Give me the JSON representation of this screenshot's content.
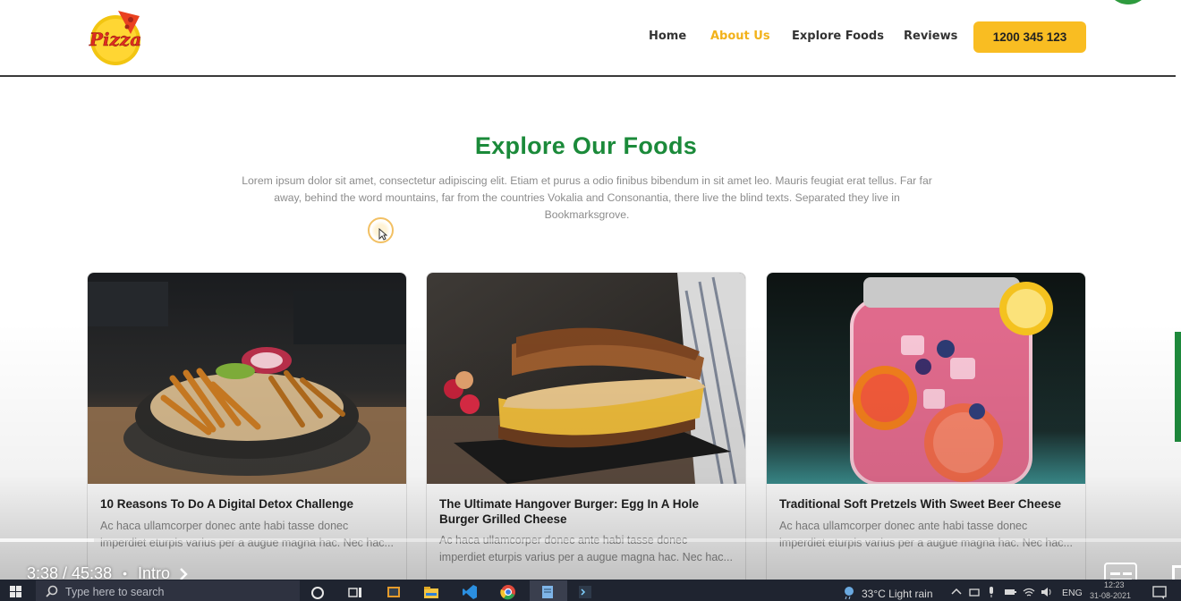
{
  "brand": {
    "logo_text": "Pizza"
  },
  "nav": [
    {
      "label": "Home",
      "active": false
    },
    {
      "label": "About Us",
      "active": true
    },
    {
      "label": "Explore Foods",
      "active": false
    },
    {
      "label": "Reviews",
      "active": false
    }
  ],
  "phone_button": "1200 345 123",
  "colors": {
    "accent": "#f9bd22",
    "brand_green": "#1b8a3a",
    "nav_active": "#f2b21b"
  },
  "section": {
    "title": "Explore Our Foods",
    "description": "Lorem ipsum dolor sit amet, consectetur adipiscing elit. Etiam et purus a odio finibus bibendum in sit amet leo. Mauris feugiat erat tellus. Far far away, behind the word mountains, far from the countries Vokalia and Consonantia, there live the blind texts. Separated they live in Bookmarksgrove."
  },
  "cards": [
    {
      "image": "fries-bowl-photo",
      "title": "10 Reasons To Do A Digital Detox Challenge",
      "text": "Ac haca ullamcorper donec ante habi tasse donec imperdiet eturpis varius per a augue magna hac. Nec hac..."
    },
    {
      "image": "grilled-sandwich-photo",
      "title": "The Ultimate Hangover Burger: Egg In A Hole Burger Grilled Cheese",
      "text": "Ac haca ullamcorper donec ante habi tasse donec imperdiet eturpis varius per a augue magna hac. Nec hac..."
    },
    {
      "image": "berry-lemonade-jar-photo",
      "title": "Traditional Soft Pretzels With Sweet Beer Cheese",
      "text": "Ac haca ullamcorper donec ante habi tasse donec imperdiet eturpis varius per a augue magna hac. Nec hac..."
    }
  ],
  "video": {
    "time": "3:38 / 45:38",
    "chapter": "Intro",
    "progress": 0.0798
  },
  "taskbar": {
    "search_placeholder": "Type here to search",
    "weather": "33°C  Light rain",
    "language": "ENG",
    "clock_time": "12:23",
    "clock_date": "31-08-2021"
  }
}
